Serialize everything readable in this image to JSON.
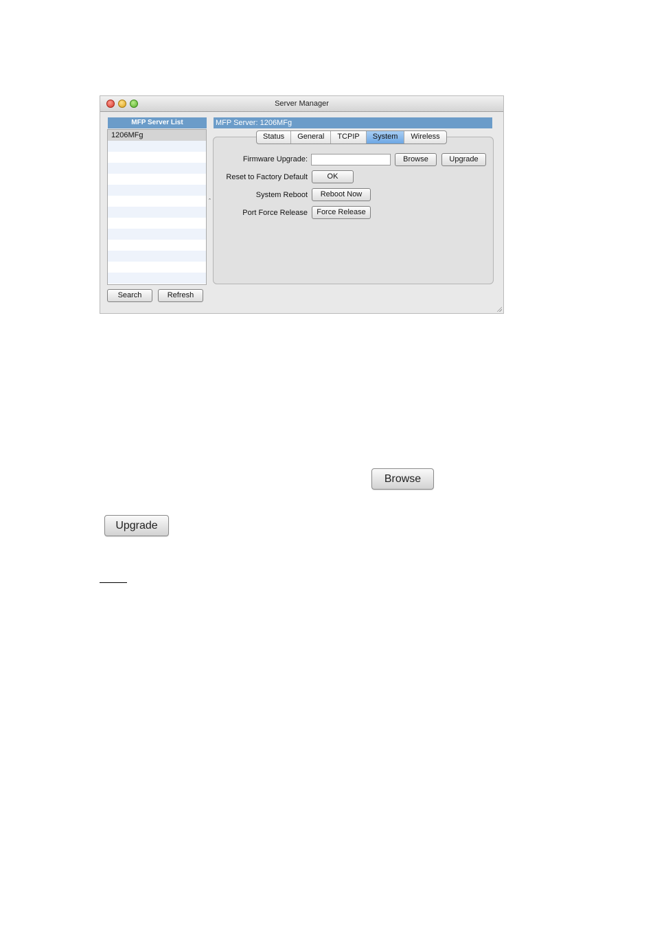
{
  "window": {
    "title": "Server Manager"
  },
  "left_panel": {
    "header": "MFP Server List",
    "servers": [
      "1206MFg"
    ],
    "search_button": "Search",
    "refresh_button": "Refresh"
  },
  "right_panel": {
    "server_header": "MFP Server: 1206MFg",
    "tabs": [
      {
        "label": "Status"
      },
      {
        "label": "General"
      },
      {
        "label": "TCPIP"
      },
      {
        "label": "System",
        "active": true
      },
      {
        "label": "Wireless"
      }
    ],
    "firmware_label": "Firmware Upgrade:",
    "firmware_value": "",
    "browse_button": "Browse",
    "upgrade_button": "Upgrade",
    "factory_label": "Reset to Factory Default",
    "ok_button": "OK",
    "reboot_label": "System Reboot",
    "reboot_button": "Reboot Now",
    "port_label": "Port Force Release",
    "force_button": "Force Release"
  },
  "standalone": {
    "browse_button": "Browse",
    "upgrade_button": "Upgrade"
  },
  "colors": {
    "header_blue": "#6b9cc9",
    "active_tab": "#6da7e4"
  }
}
